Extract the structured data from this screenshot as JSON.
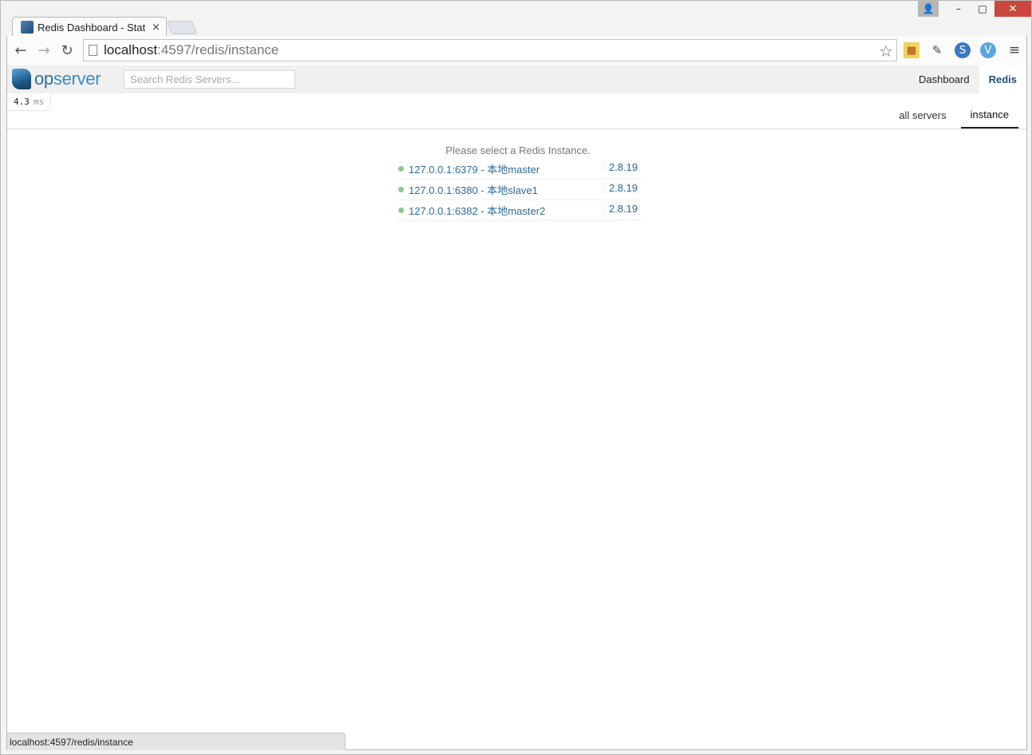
{
  "browser": {
    "tab_title": "Redis Dashboard - Stat",
    "tab_close": "×",
    "url_host": "localhost",
    "url_rest": ":4597/redis/instance",
    "status_url": "localhost:4597/redis/instance",
    "window_controls": {
      "user": "👤",
      "minimize": "–",
      "maximize": "□",
      "close": "✕"
    },
    "nav": {
      "back": "←",
      "forward": "→",
      "reload": "↻"
    },
    "star": "☆",
    "menu": "≡",
    "extensions": [
      "firewall-icon",
      "evernote-icon",
      "skype-icon",
      "vimium-icon"
    ]
  },
  "app": {
    "logo_op": "op",
    "logo_server": "server",
    "search_placeholder": "Search Redis Servers...",
    "nav_links": [
      "Dashboard",
      "Redis"
    ],
    "timing_value": "4.3",
    "timing_unit": "ms",
    "subtabs": [
      "all servers",
      "instance"
    ],
    "prompt": "Please select a Redis Instance.",
    "instances": [
      {
        "name": "127.0.0.1:6379 - 本地master",
        "version": "2.8.19",
        "status": "up"
      },
      {
        "name": "127.0.0.1:6380 - 本地slave1",
        "version": "2.8.19",
        "status": "up"
      },
      {
        "name": "127.0.0.1:6382 - 本地master2",
        "version": "2.8.19",
        "status": "up"
      }
    ]
  },
  "colors": {
    "accent": "#2e6b9b",
    "status_up": "#8dc88d",
    "close_button": "#c9473d"
  }
}
